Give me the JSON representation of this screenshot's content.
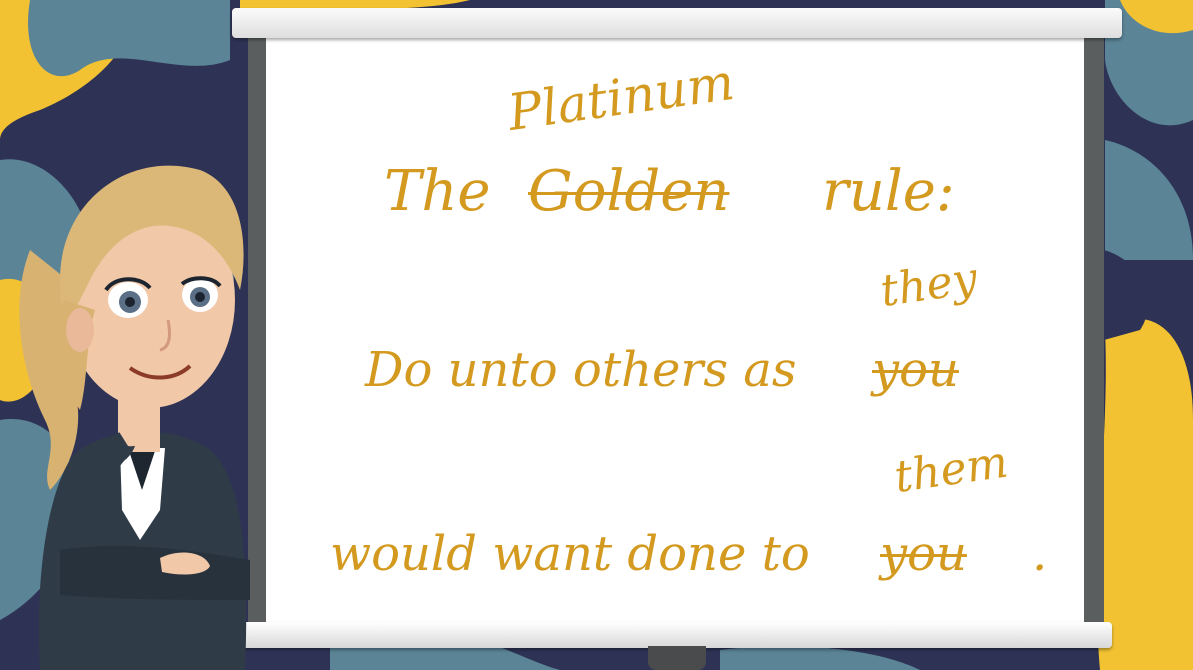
{
  "slide": {
    "title": {
      "prefix": "The",
      "struck_word": "Golden",
      "replacement_word": "Platinum",
      "suffix": "rule:"
    },
    "line2": {
      "main": "Do unto others as",
      "struck_word": "you",
      "replacement_word": "they"
    },
    "line3": {
      "main": "would want done to",
      "struck_word": "you",
      "replacement_word": "them",
      "end": "."
    }
  },
  "colors": {
    "text": "#d39a1f",
    "background_navy": "#2e3355",
    "background_teal": "#5b8597",
    "background_yellow": "#f2c232"
  },
  "characters": {
    "presenter": "woman-presenter-icon"
  }
}
